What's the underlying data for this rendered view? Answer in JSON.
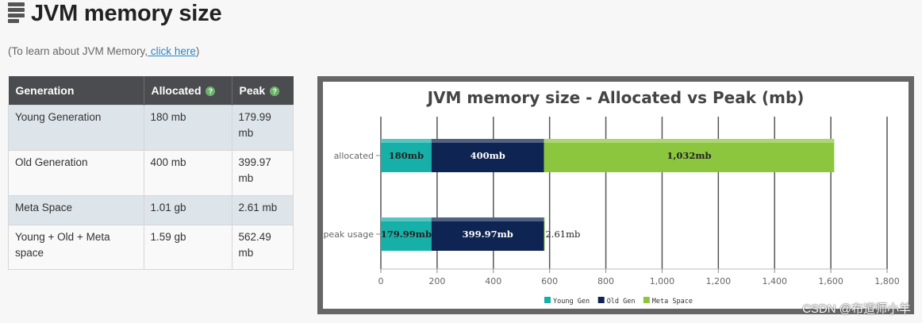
{
  "page": {
    "title": "JVM memory size",
    "learn_prefix": "(To learn about JVM Memory,",
    "learn_link": " click here",
    "learn_suffix": ")"
  },
  "table": {
    "headers": [
      "Generation",
      "Allocated",
      "Peak"
    ],
    "help_icon": "?",
    "rows": [
      [
        "Young Generation",
        "180 mb",
        "179.99 mb"
      ],
      [
        "Old Generation",
        "400 mb",
        "399.97 mb"
      ],
      [
        "Meta Space",
        "1.01 gb",
        "2.61 mb"
      ],
      [
        "Young + Old + Meta space",
        "1.59 gb",
        "562.49 mb"
      ]
    ]
  },
  "chart_data": {
    "type": "bar",
    "orientation": "horizontal",
    "stacked": true,
    "title": "JVM memory size - Allocated vs Peak (mb)",
    "categories": [
      "allocated",
      "peak usage"
    ],
    "series": [
      {
        "name": "Young Gen",
        "color": "#17b0a8",
        "values": [
          180,
          179.99
        ],
        "labels": [
          "180mb",
          "179.99mb"
        ]
      },
      {
        "name": "Old Gen",
        "color": "#0e2453",
        "values": [
          400,
          399.97
        ],
        "labels": [
          "400mb",
          "399.97mb"
        ]
      },
      {
        "name": "Meta Space",
        "color": "#8cc63f",
        "values": [
          1032,
          2.61
        ],
        "labels": [
          "1,032mb",
          "2.61mb"
        ]
      }
    ],
    "xlim": [
      0,
      1800
    ],
    "xticks": [
      0,
      200,
      400,
      600,
      800,
      1000,
      1200,
      1400,
      1600,
      1800
    ],
    "xtick_labels": [
      "0",
      "200",
      "400",
      "600",
      "800",
      "1,000",
      "1,200",
      "1,400",
      "1,600",
      "1,800"
    ],
    "grid": true,
    "legend_position": "bottom"
  },
  "watermark": "CSDN @布道师小羊"
}
